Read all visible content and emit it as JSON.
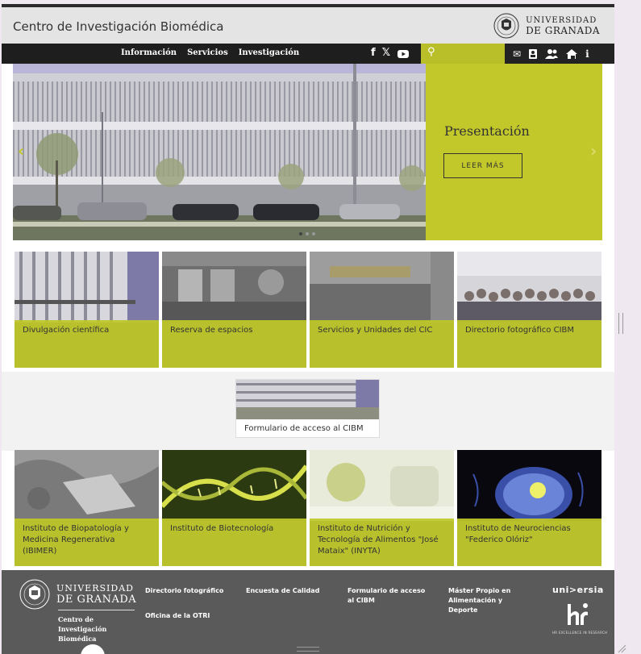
{
  "header": {
    "site_title": "Centro de Investigación Biomédica",
    "university_line1": "UNIVERSIDAD",
    "university_line2": "DE GRANADA"
  },
  "nav": {
    "links": [
      "Información",
      "Servicios",
      "Investigación"
    ],
    "social_icons": [
      "facebook-icon",
      "x-icon",
      "youtube-icon"
    ],
    "tool_icons": [
      "mail-icon",
      "directory-icon",
      "users-icon",
      "home-icon",
      "info-icon"
    ]
  },
  "slider": {
    "heading": "Presentación",
    "button": "LEER MÁS",
    "prev": "‹",
    "next": "›"
  },
  "tiles_row1": [
    {
      "label": "Divulgación científica"
    },
    {
      "label": "Reserva de espacios"
    },
    {
      "label": "Servicios y Unidades del CIC"
    },
    {
      "label": "Directorio fotográfico CIBM"
    }
  ],
  "access_form": {
    "label": "Formulario de acceso al CIBM"
  },
  "tiles_row2": [
    {
      "label": "Instituto de Biopatología y Medicina Regenerativa (IBIMER)"
    },
    {
      "label": "Instituto de Biotecnología"
    },
    {
      "label": "Instituto de Nutrición y Tecnología de Alimentos \"José Mataix\" (INYTA)"
    },
    {
      "label": "Instituto de Neurociencias \"Federico Olóriz\""
    }
  ],
  "footer": {
    "university_line1": "UNIVERSIDAD",
    "university_line2": "DE GRANADA",
    "subtitle": "Centro de Investigación Biomédica",
    "links": [
      "Directorio fotográfico",
      "Encuesta de Calidad",
      "Formulario de acceso al CIBM",
      "Máster Propio en Alimentación y Deporte",
      "Oficina de la OTRI"
    ],
    "universia": "uni>ersia",
    "hr_caption": "HR EXCELLENCE IN RESEARCH"
  },
  "colors": {
    "accent": "#c2c82a",
    "navbar": "#1e1e1e",
    "footer": "#5a5a5a"
  }
}
